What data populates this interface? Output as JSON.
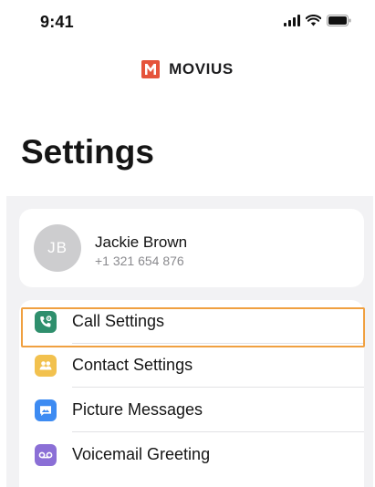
{
  "status_bar": {
    "time": "9:41"
  },
  "brand": {
    "name": "MOVIUS",
    "color": "#e5533b"
  },
  "page_title": "Settings",
  "profile": {
    "initials": "JB",
    "name": "Jackie Brown",
    "phone": "+1 321 654 876"
  },
  "menu": [
    {
      "label": "Call Settings",
      "icon": "phone-gear-icon",
      "color": "#2f8f6d",
      "highlighted": true
    },
    {
      "label": "Contact Settings",
      "icon": "contacts-icon",
      "color": "#f2c14e"
    },
    {
      "label": "Picture Messages",
      "icon": "picture-message-icon",
      "color": "#3d8bf2"
    },
    {
      "label": "Voicemail Greeting",
      "icon": "voicemail-icon",
      "color": "#8b6fd6"
    }
  ],
  "highlight_color": "#f0a040"
}
